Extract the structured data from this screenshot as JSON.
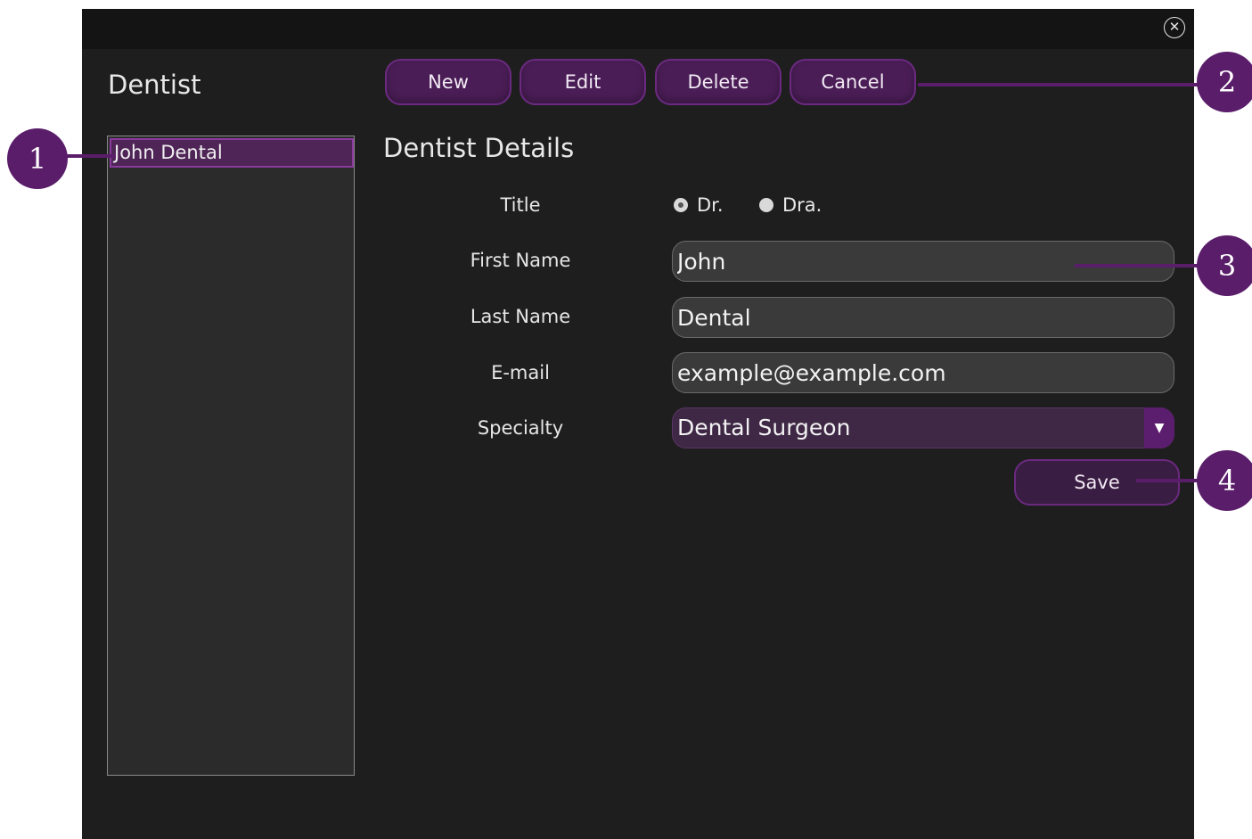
{
  "window": {
    "close_icon": "close-circle-icon"
  },
  "sidebar": {
    "title": "Dentist",
    "items": [
      {
        "label": "John Dental",
        "selected": true
      }
    ]
  },
  "toolbar": {
    "new_label": "New",
    "edit_label": "Edit",
    "delete_label": "Delete",
    "cancel_label": "Cancel"
  },
  "details": {
    "title": "Dentist Details",
    "labels": {
      "title": "Title",
      "first_name": "First Name",
      "last_name": "Last Name",
      "email": "E-mail",
      "specialty": "Specialty"
    },
    "title_options": [
      {
        "label": "Dr.",
        "checked": true
      },
      {
        "label": "Dra.",
        "checked": false
      }
    ],
    "first_name": "John",
    "last_name": "Dental",
    "email": "example@example.com",
    "specialty": "Dental Surgeon",
    "save_label": "Save"
  },
  "callouts": {
    "c1": "1",
    "c2": "2",
    "c3": "3",
    "c4": "4"
  },
  "colors": {
    "accent": "#5a1d6a",
    "button": "#4a1d56",
    "background": "#1e1e1e"
  }
}
